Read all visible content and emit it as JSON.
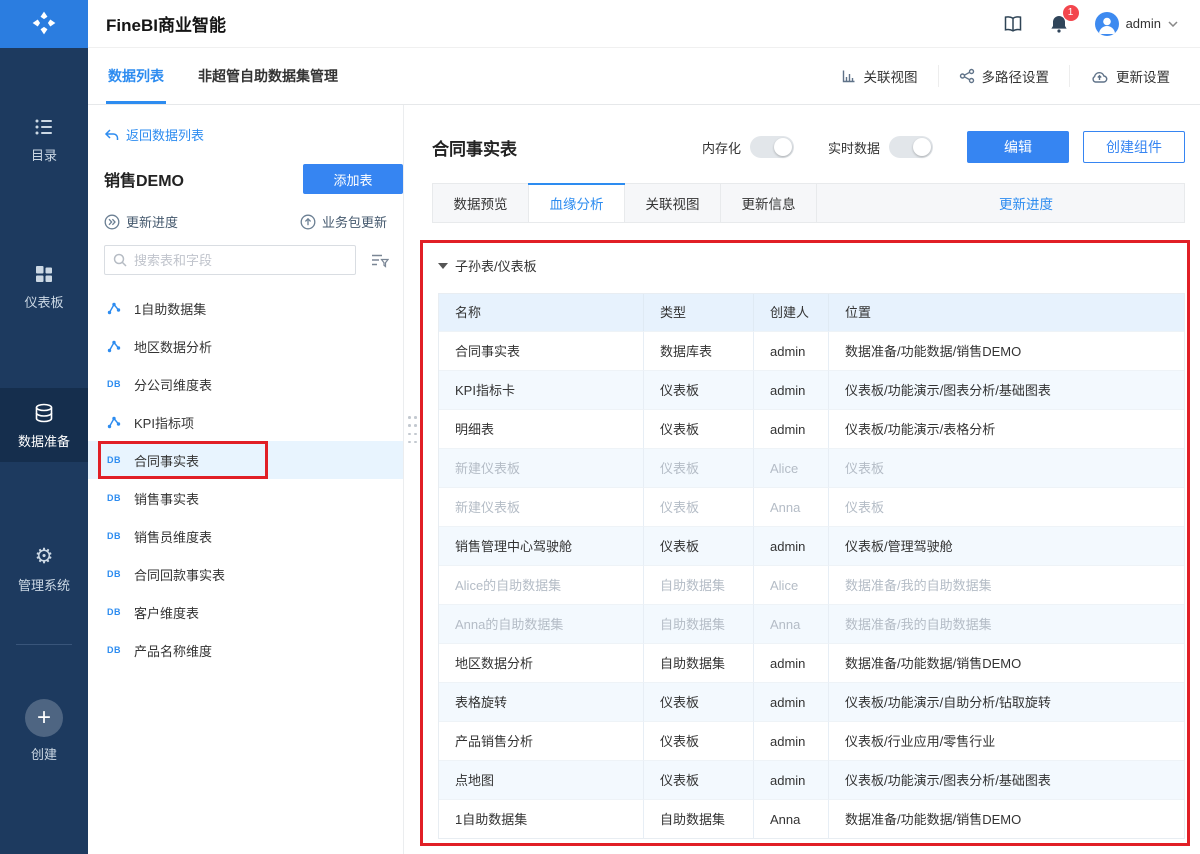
{
  "app": {
    "title": "FineBI商业智能"
  },
  "header": {
    "badge": "1",
    "user": "admin"
  },
  "sidebar": {
    "items": [
      {
        "label": "目录"
      },
      {
        "label": "仪表板"
      },
      {
        "label": "数据准备"
      },
      {
        "label": "管理系统"
      },
      {
        "label": "创建"
      }
    ]
  },
  "nav_tabs": {
    "data_list": "数据列表",
    "nonadmin_manage": "非超管自助数据集管理",
    "actions": [
      {
        "label": "关联视图"
      },
      {
        "label": "多路径设置"
      },
      {
        "label": "更新设置"
      }
    ]
  },
  "panel": {
    "back_label": "返回数据列表",
    "package_name": "销售DEMO",
    "add_table_label": "添加表",
    "update_progress_label": "更新进度",
    "package_update_label": "业务包更新",
    "search_placeholder": "搜索表和字段",
    "items": [
      {
        "label": "1自助数据集",
        "type": "dataset"
      },
      {
        "label": "地区数据分析",
        "type": "dataset"
      },
      {
        "label": "分公司维度表",
        "type": "db"
      },
      {
        "label": "KPI指标项",
        "type": "dataset"
      },
      {
        "label": "合同事实表",
        "type": "db",
        "selected": true,
        "annotated": true
      },
      {
        "label": "销售事实表",
        "type": "db"
      },
      {
        "label": "销售员维度表",
        "type": "db"
      },
      {
        "label": "合同回款事实表",
        "type": "db"
      },
      {
        "label": "客户维度表",
        "type": "db"
      },
      {
        "label": "产品名称维度",
        "type": "db"
      }
    ]
  },
  "main": {
    "title": "合同事实表",
    "memory_toggle_label": "内存化",
    "realtime_toggle_label": "实时数据",
    "edit_label": "编辑",
    "create_component_label": "创建组件",
    "tabs": [
      "数据预览",
      "血缘分析",
      "关联视图",
      "更新信息"
    ],
    "active_tab": "血缘分析",
    "progress_link": "更新进度",
    "section_title": "子孙表/仪表板",
    "table": {
      "headers": [
        "名称",
        "类型",
        "创建人",
        "位置"
      ],
      "rows": [
        {
          "name": "合同事实表",
          "type": "数据库表",
          "creator": "admin",
          "location": "数据准备/功能数据/销售DEMO",
          "muted": false
        },
        {
          "name": "KPI指标卡",
          "type": "仪表板",
          "creator": "admin",
          "location": "仪表板/功能演示/图表分析/基础图表",
          "muted": false
        },
        {
          "name": "明细表",
          "type": "仪表板",
          "creator": "admin",
          "location": "仪表板/功能演示/表格分析",
          "muted": false
        },
        {
          "name": "新建仪表板",
          "type": "仪表板",
          "creator": "Alice",
          "location": "仪表板",
          "muted": true
        },
        {
          "name": "新建仪表板",
          "type": "仪表板",
          "creator": "Anna",
          "location": "仪表板",
          "muted": true
        },
        {
          "name": "销售管理中心驾驶舱",
          "type": "仪表板",
          "creator": "admin",
          "location": "仪表板/管理驾驶舱",
          "muted": false
        },
        {
          "name": "Alice的自助数据集",
          "type": "自助数据集",
          "creator": "Alice",
          "location": "数据准备/我的自助数据集",
          "muted": true
        },
        {
          "name": "Anna的自助数据集",
          "type": "自助数据集",
          "creator": "Anna",
          "location": "数据准备/我的自助数据集",
          "muted": true
        },
        {
          "name": "地区数据分析",
          "type": "自助数据集",
          "creator": "admin",
          "location": "数据准备/功能数据/销售DEMO",
          "muted": false
        },
        {
          "name": "表格旋转",
          "type": "仪表板",
          "creator": "admin",
          "location": "仪表板/功能演示/自助分析/钻取旋转",
          "muted": false
        },
        {
          "name": "产品销售分析",
          "type": "仪表板",
          "creator": "admin",
          "location": "仪表板/行业应用/零售行业",
          "muted": false
        },
        {
          "name": "点地图",
          "type": "仪表板",
          "creator": "admin",
          "location": "仪表板/功能演示/图表分析/基础图表",
          "muted": false
        },
        {
          "name": "1自助数据集",
          "type": "自助数据集",
          "creator": "Anna",
          "location": "数据准备/功能数据/销售DEMO",
          "muted": false
        }
      ]
    }
  },
  "colors": {
    "accent": "#2d8cf0",
    "button_blue": "#3685f2",
    "sidebar_bg": "#1d3a5f",
    "annotation_red": "#e11f26",
    "badge_red": "#f3464d"
  }
}
